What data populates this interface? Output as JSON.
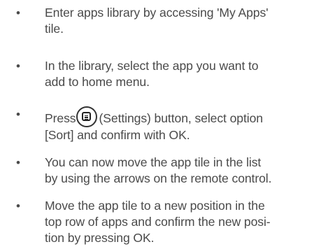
{
  "instructions": [
    {
      "bullet": "•",
      "lines": [
        "Enter apps library by accessing 'My Apps'",
        "tile."
      ]
    },
    {
      "bullet": "•",
      "lines": [
        "In the library, select the app you want to",
        "add to home menu."
      ]
    },
    {
      "bullet": "•",
      "pre": "Press",
      "post": "(Settings) button, select option",
      "lines": [
        "[Sort] and confirm with OK."
      ],
      "icon": "settings-button-icon"
    },
    {
      "bullet": "•",
      "lines": [
        "You can now move the app tile in the list",
        "by using the arrows on the remote control."
      ]
    },
    {
      "bullet": "•",
      "lines": [
        "Move the app tile to a new position in the",
        "top row of apps and confirm the new posi-",
        "tion by pressing OK."
      ]
    }
  ]
}
